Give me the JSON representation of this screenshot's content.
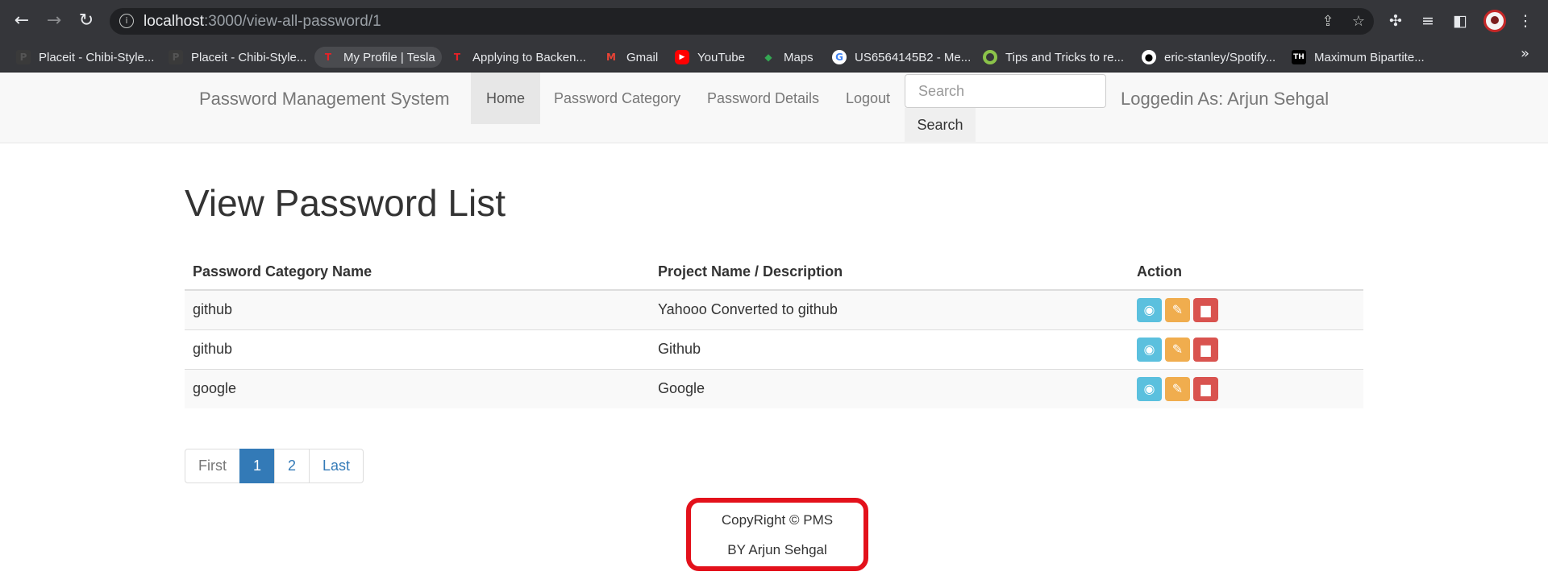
{
  "browser": {
    "url_host": "localhost",
    "url_path": ":3000/view-all-password/1",
    "bookmarks": [
      {
        "label": "Placeit - Chibi-Style..."
      },
      {
        "label": "Placeit - Chibi-Style..."
      },
      {
        "label": "My Profile | Tesla"
      },
      {
        "label": "Applying to Backen..."
      },
      {
        "label": "Gmail"
      },
      {
        "label": "YouTube"
      },
      {
        "label": "Maps"
      },
      {
        "label": "US6564145B2 - Me..."
      },
      {
        "label": "Tips and Tricks to re..."
      },
      {
        "label": "eric-stanley/Spotify..."
      },
      {
        "label": "Maximum Bipartite..."
      }
    ]
  },
  "navbar": {
    "brand": "Password Management System",
    "items": [
      {
        "label": "Home"
      },
      {
        "label": "Password Category"
      },
      {
        "label": "Password Details"
      },
      {
        "label": "Logout"
      }
    ],
    "search_placeholder": "Search",
    "search_button": "Search",
    "logged_in": "Loggedin As: Arjun Sehgal"
  },
  "main": {
    "title": "View Password List",
    "table": {
      "headers": [
        "Password Category Name",
        "Project Name / Description",
        "Action"
      ],
      "rows": [
        {
          "category": "github",
          "project": "Yahooo Converted to github"
        },
        {
          "category": "github",
          "project": "Github"
        },
        {
          "category": "google",
          "project": "Google"
        }
      ]
    },
    "pagination": [
      "First",
      "1",
      "2",
      "Last"
    ]
  },
  "footer": {
    "line1": "CopyRight © PMS",
    "line2": "BY Arjun Sehgal"
  },
  "colors": {
    "view": "#5bc0de",
    "edit": "#f0ad4e",
    "delete": "#d9534f",
    "primary": "#337ab7",
    "highlight": "#e3111b"
  }
}
